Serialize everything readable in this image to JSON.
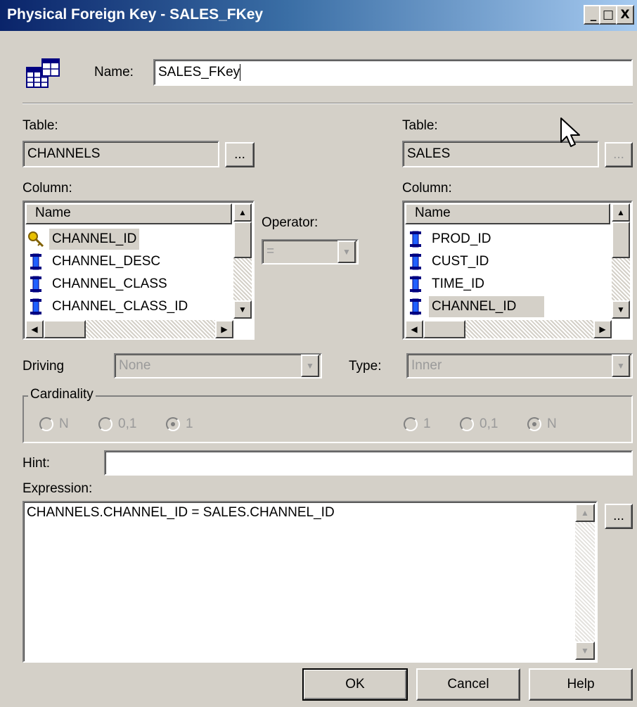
{
  "window": {
    "title": "Physical Foreign Key - SALES_FKey",
    "minimize": "_",
    "maximize": "□",
    "close": "X"
  },
  "name": {
    "label": "Name:",
    "value": "SALES_FKey"
  },
  "left": {
    "table_label": "Table:",
    "table_value": "CHANNELS",
    "browse": "...",
    "column_label": "Column:",
    "header": "Name",
    "columns": [
      {
        "name": "CHANNEL_ID",
        "icon": "key-icon",
        "selected": true
      },
      {
        "name": "CHANNEL_DESC",
        "icon": "column-icon",
        "selected": false
      },
      {
        "name": "CHANNEL_CLASS",
        "icon": "column-icon",
        "selected": false
      },
      {
        "name": "CHANNEL_CLASS_ID",
        "icon": "column-icon",
        "selected": false
      }
    ]
  },
  "right": {
    "table_label": "Table:",
    "table_value": "SALES",
    "browse": "...",
    "column_label": "Column:",
    "header": "Name",
    "columns": [
      {
        "name": "PROD_ID",
        "icon": "column-icon",
        "selected": false
      },
      {
        "name": "CUST_ID",
        "icon": "column-icon",
        "selected": false
      },
      {
        "name": "TIME_ID",
        "icon": "column-icon",
        "selected": false
      },
      {
        "name": "CHANNEL_ID",
        "icon": "column-icon",
        "selected": true
      }
    ]
  },
  "operator": {
    "label": "Operator:",
    "value": "="
  },
  "driving": {
    "label": "Driving",
    "value": "None"
  },
  "type": {
    "label": "Type:",
    "value": "Inner"
  },
  "cardinality": {
    "label": "Cardinality",
    "left": [
      {
        "label": "N",
        "checked": false
      },
      {
        "label": "0,1",
        "checked": false
      },
      {
        "label": "1",
        "checked": true
      }
    ],
    "right": [
      {
        "label": "1",
        "checked": false
      },
      {
        "label": "0,1",
        "checked": false
      },
      {
        "label": "N",
        "checked": true
      }
    ]
  },
  "hint": {
    "label": "Hint:",
    "value": ""
  },
  "expression": {
    "label": "Expression:",
    "value": "CHANNELS.CHANNEL_ID = SALES.CHANNEL_ID",
    "browse": "..."
  },
  "buttons": {
    "ok": "OK",
    "cancel": "Cancel",
    "help": "Help"
  }
}
